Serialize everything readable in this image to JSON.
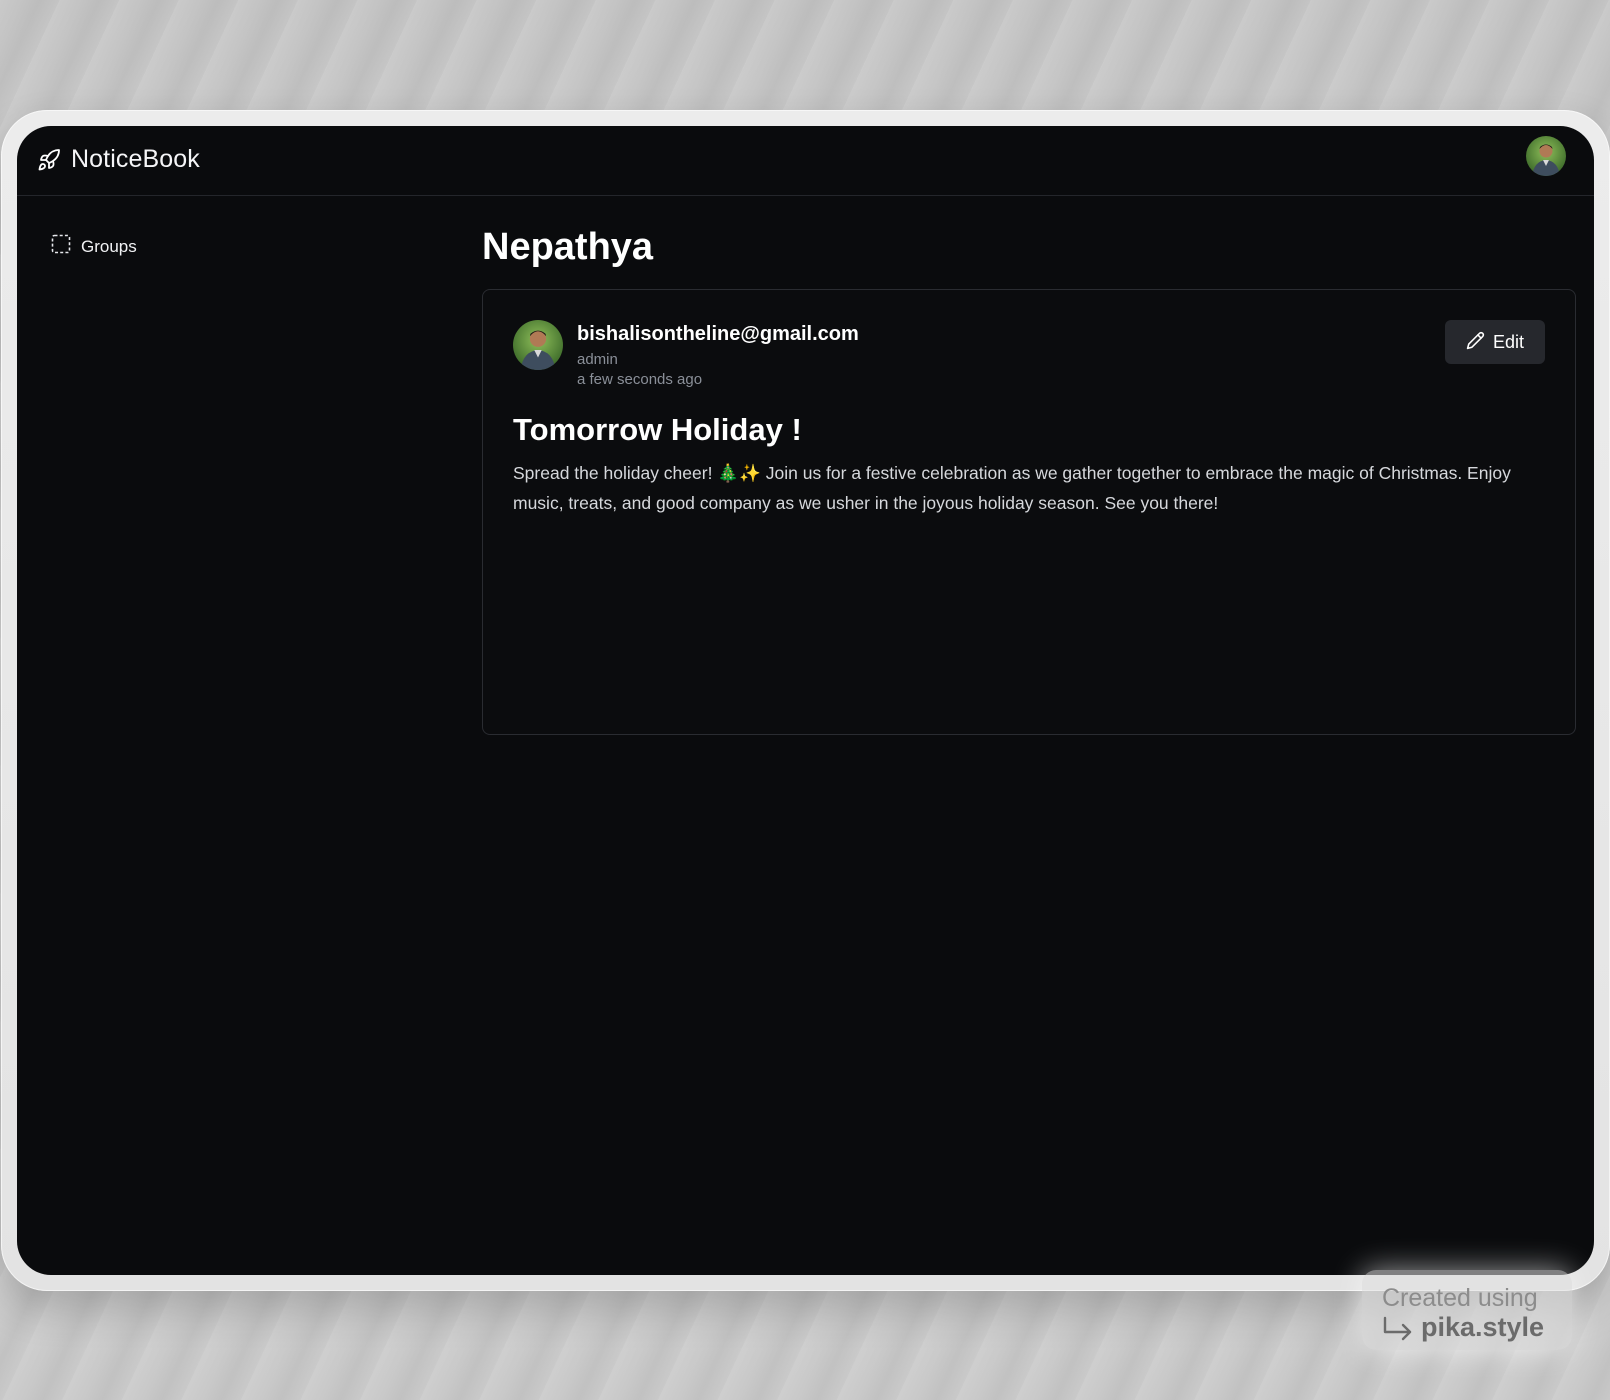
{
  "app": {
    "name": "NoticeBook",
    "logo_icon": "rocket-icon",
    "user_avatar": "user-avatar-photo"
  },
  "sidebar": {
    "items": [
      {
        "label": "Groups",
        "icon": "dashed-square-icon"
      }
    ]
  },
  "main": {
    "page_title": "Nepathya",
    "notice": {
      "author_email": "bishalisontheline@gmail.com",
      "author_role": "admin",
      "posted_time": "a few seconds ago",
      "edit_label": "Edit",
      "edit_icon": "pencil-icon",
      "title": "Tomorrow Holiday !",
      "body": "Spread the holiday cheer! 🎄✨ Join us for a festive celebration as we gather together to embrace the magic of Christmas. Enjoy music, treats, and good company as we usher in the joyous holiday season. See you there!"
    }
  },
  "watermark": {
    "line1": "Created using",
    "line2": "pika.style"
  },
  "colors": {
    "screen_bg": "#0a0b0d",
    "card_border": "#2a2c31",
    "button_bg": "#26282d",
    "muted_text": "#8a8f98",
    "body_text": "#d6d8dc"
  }
}
